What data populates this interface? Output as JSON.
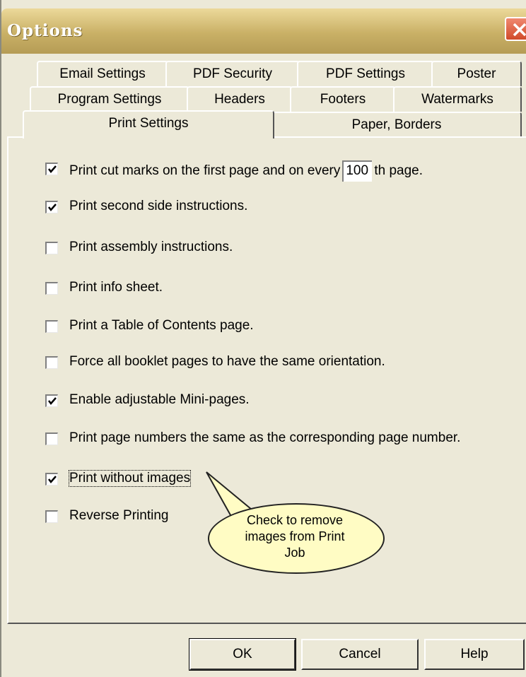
{
  "window": {
    "title": "Options"
  },
  "tabs": {
    "row1": [
      "Email Settings",
      "PDF Security",
      "PDF Settings",
      "Poster"
    ],
    "row2": [
      "Program Settings",
      "Headers",
      "Footers",
      "Watermarks"
    ],
    "row3": [
      "Print Settings",
      "Paper, Borders"
    ],
    "selected": "Print Settings"
  },
  "options": {
    "cut_marks": {
      "prefix": "Print cut marks on the first page and on every",
      "value": "100",
      "suffix": "th page.",
      "checked": true
    },
    "second_side": {
      "label": "Print second side instructions.",
      "checked": true
    },
    "assembly": {
      "label": "Print assembly instructions.",
      "checked": false
    },
    "info_sheet": {
      "label": "Print info sheet.",
      "checked": false
    },
    "toc": {
      "label": "Print a Table of Contents page.",
      "checked": false
    },
    "force_orientation": {
      "label": "Force all booklet pages to have the same orientation.",
      "checked": false
    },
    "mini_pages": {
      "label": "Enable adjustable Mini-pages.",
      "checked": true
    },
    "page_numbers": {
      "label": "Print page numbers the same as the corresponding page number.",
      "checked": false
    },
    "without_images": {
      "label": "Print without images",
      "checked": true
    },
    "reverse": {
      "label": "Reverse Printing",
      "checked": false
    }
  },
  "tooltip": {
    "line1": "Check to remove",
    "line2": "images from Print",
    "line3": "Job"
  },
  "buttons": {
    "ok": "OK",
    "cancel": "Cancel",
    "help": "Help"
  },
  "colors": {
    "face": "#ece9d8",
    "titlebar": "#c9b066",
    "balloon": "#fffcc4",
    "close": "#d04a2a"
  }
}
